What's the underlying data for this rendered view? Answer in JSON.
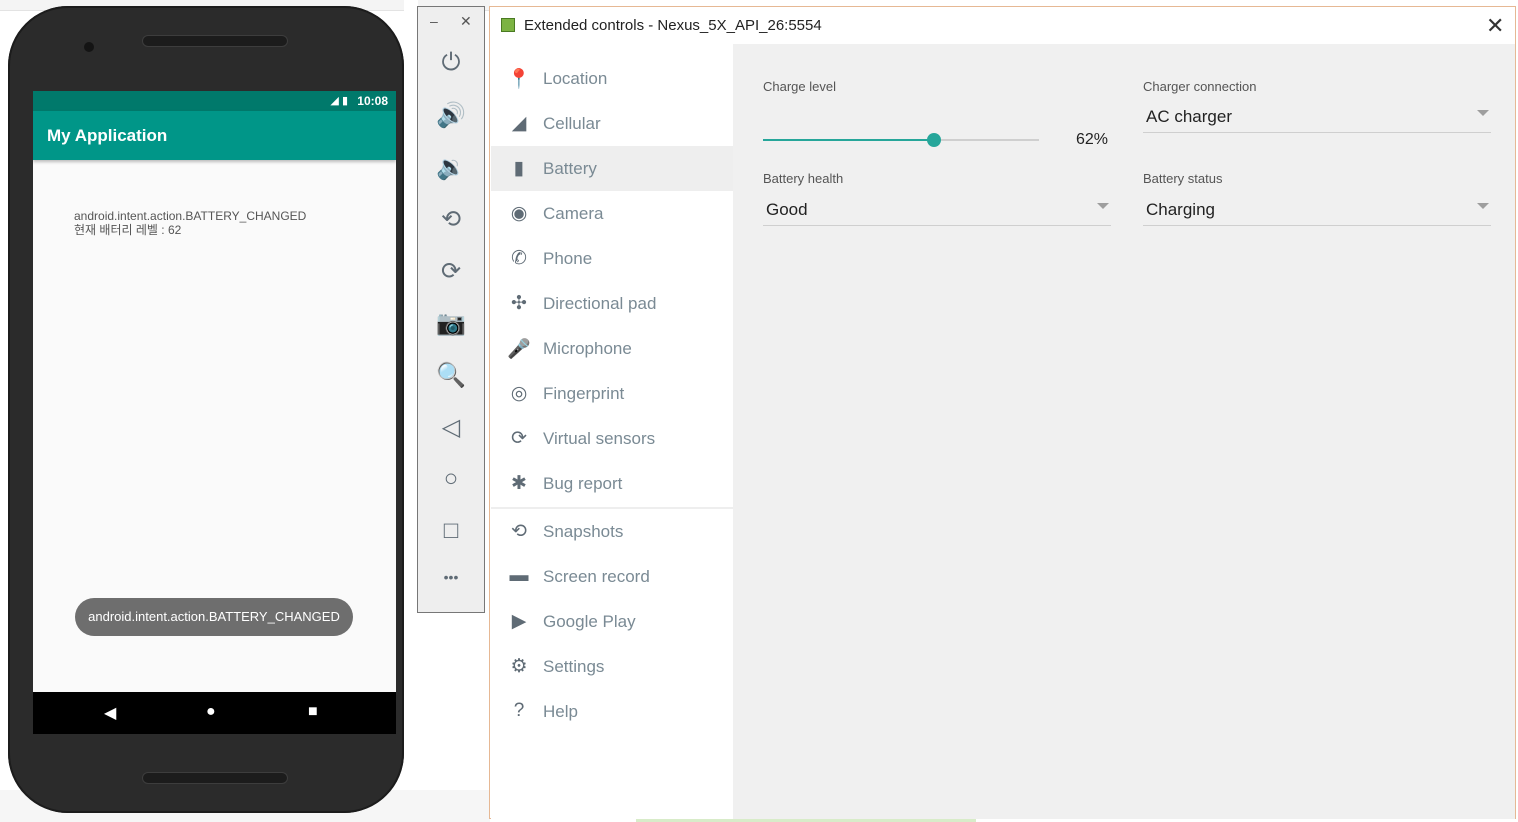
{
  "phone": {
    "status_time": "10:08",
    "app_title": "My Application",
    "content_line1": "android.intent.action.BATTERY_CHANGED",
    "content_line2": "현재 배터리 레벨 : 62",
    "toast": "android.intent.action.BATTERY_CHANGED",
    "nav": {
      "back": "◀",
      "home": "●",
      "recents": "■"
    }
  },
  "toolbar": {
    "minimize": "–",
    "close": "✕",
    "icons": [
      {
        "name": "power-icon",
        "glyph": "⏻"
      },
      {
        "name": "volume-up-icon",
        "glyph": "🔊"
      },
      {
        "name": "volume-down-icon",
        "glyph": "🔉"
      },
      {
        "name": "rotate-left-icon",
        "glyph": "⟲"
      },
      {
        "name": "rotate-right-icon",
        "glyph": "⟳"
      },
      {
        "name": "camera-icon",
        "glyph": "📷"
      },
      {
        "name": "zoom-icon",
        "glyph": "🔍"
      },
      {
        "name": "back-icon",
        "glyph": "◁"
      },
      {
        "name": "home-icon",
        "glyph": "○"
      },
      {
        "name": "overview-icon",
        "glyph": "□"
      },
      {
        "name": "more-icon",
        "glyph": "•••"
      }
    ]
  },
  "dialog": {
    "title": "Extended controls - Nexus_5X_API_26:5554",
    "close": "✕",
    "menu": [
      {
        "label": "Location",
        "icon": "location-icon",
        "glyph": "📍"
      },
      {
        "label": "Cellular",
        "icon": "cellular-icon",
        "glyph": "◢"
      },
      {
        "label": "Battery",
        "icon": "battery-icon",
        "glyph": "▮",
        "active": true
      },
      {
        "label": "Camera",
        "icon": "camera-icon",
        "glyph": "◉"
      },
      {
        "label": "Phone",
        "icon": "phone-icon",
        "glyph": "✆"
      },
      {
        "label": "Directional pad",
        "icon": "dpad-icon",
        "glyph": "✣"
      },
      {
        "label": "Microphone",
        "icon": "microphone-icon",
        "glyph": "🎤"
      },
      {
        "label": "Fingerprint",
        "icon": "fingerprint-icon",
        "glyph": "◎"
      },
      {
        "label": "Virtual sensors",
        "icon": "virtual-sensors-icon",
        "glyph": "⟳"
      },
      {
        "label": "Bug report",
        "icon": "bug-icon",
        "glyph": "✱"
      },
      {
        "label": "Snapshots",
        "icon": "history-icon",
        "glyph": "⟲"
      },
      {
        "label": "Screen record",
        "icon": "video-icon",
        "glyph": "▬"
      },
      {
        "label": "Google Play",
        "icon": "play-store-icon",
        "glyph": "▶"
      },
      {
        "label": "Settings",
        "icon": "gear-icon",
        "glyph": "⚙"
      },
      {
        "label": "Help",
        "icon": "help-icon",
        "glyph": "?"
      }
    ],
    "battery": {
      "charge_level_label": "Charge level",
      "charge_level_value": "62%",
      "charge_level": 62,
      "charger_connection_label": "Charger connection",
      "charger_connection_value": "AC charger",
      "battery_health_label": "Battery health",
      "battery_health_value": "Good",
      "battery_status_label": "Battery status",
      "battery_status_value": "Charging"
    }
  }
}
